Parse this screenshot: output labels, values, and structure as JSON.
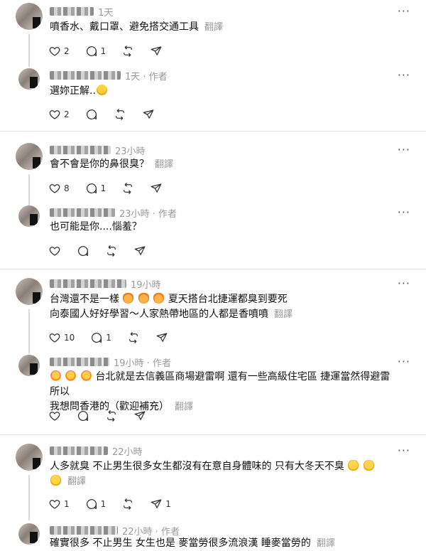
{
  "common": {
    "translate_label": "翻譯",
    "more_label": "···"
  },
  "threads": [
    {
      "parent": {
        "time": "1天",
        "text": "噴香水、戴口罩、避免搭交通工具",
        "likes": "2",
        "replies": "1"
      },
      "reply": {
        "time": "1天 · 作者",
        "text": "選妳正解..",
        "likes": "2"
      }
    },
    {
      "parent": {
        "time": "23小時",
        "text": "會不會是你的鼻很臭？",
        "likes": "8",
        "replies": "1"
      },
      "reply": {
        "time": "23小時 · 作者",
        "text": "也可能是你....惱羞？"
      }
    },
    {
      "parent": {
        "time": "19小時",
        "text_a": "台灣還不是一樣",
        "text_b": "夏天搭台北捷運都臭到要死",
        "text_c": "向泰國人好好學習～人家熱帶地區的人都是香噴噴",
        "likes": "10",
        "replies": "1"
      },
      "reply": {
        "time": "19小時 · 作者",
        "text_a": "台北就是去信義區商場避雷啊 還有一些高級住宅區 捷運當然得避雷 所以",
        "text_b": "我想問香港的（歡迎補充）"
      }
    },
    {
      "parent": {
        "time": "22小時",
        "text": "人多就臭 不止男生很多女生都沒有在意自身體味的 只有大冬天不臭",
        "likes": "1",
        "replies": "1",
        "shares": "1"
      },
      "reply": {
        "time": "22小時 · 作者",
        "text": "確實很多 不止男生 女生也是 麥當勞很多流浪漢 睡麥當勞的"
      }
    }
  ]
}
